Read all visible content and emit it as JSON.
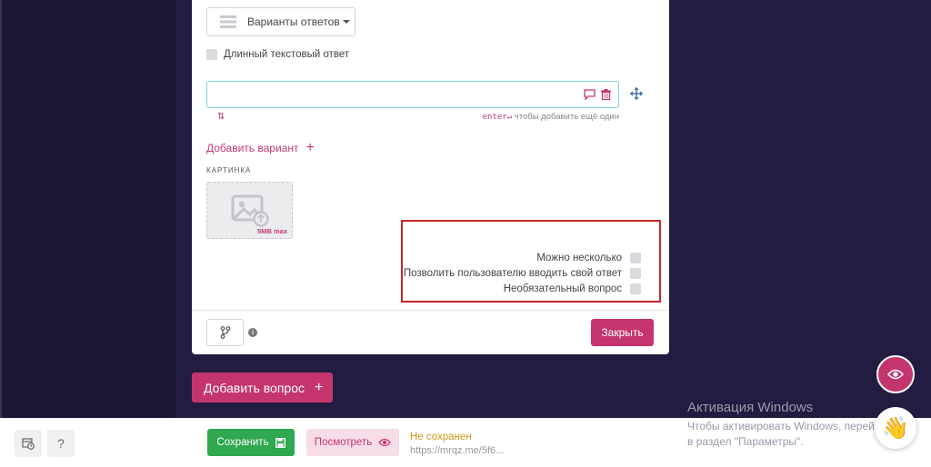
{
  "editor": {
    "answers_button_label": "Варианты ответов",
    "long_text_label": "Длинный текстовый ответ",
    "variant_value": "",
    "sort_glyph": "⇅",
    "enter_key": "enter↵",
    "enter_hint": " чтобы добавить ещё один",
    "add_variant_label": "Добавить вариант",
    "add_variant_plus": "+",
    "picture_label": "КАРТИНКА",
    "picture_size": "5MB max",
    "options": [
      {
        "label": "Можно несколько",
        "checked": false
      },
      {
        "label": "Позволить пользователю вводить свой ответ",
        "checked": false
      },
      {
        "label": "Необязательный вопрос",
        "checked": false
      }
    ],
    "info_glyph": "i",
    "close_label": "Закрыть"
  },
  "add_question": {
    "label": "Добавить вопрос",
    "plus": "+"
  },
  "overlay": {
    "activation_title": "Активация Windows",
    "activation_text": "Чтобы активировать Windows, перейдите в раздел \"Параметры\"."
  },
  "bottom_bar": {
    "help_glyph": "?",
    "save_label": "Сохранить",
    "preview_label": "Посмотреть",
    "status_text": "Не сохранен",
    "url_text": "https://mrqz.me/5f6...",
    "hand_emoji": "👋"
  },
  "colors": {
    "accent": "#c4356e",
    "save": "#2fa84f",
    "status": "#d29a1c",
    "highlight_frame": "#c8262e",
    "background": "#221d40"
  },
  "icons": [
    "list-icon",
    "comment-icon",
    "trash-icon",
    "move-icon",
    "image-upload-icon",
    "branch-icon",
    "info-icon",
    "eye-icon",
    "clock-calendar-icon",
    "floppy-icon",
    "hand-icon"
  ]
}
